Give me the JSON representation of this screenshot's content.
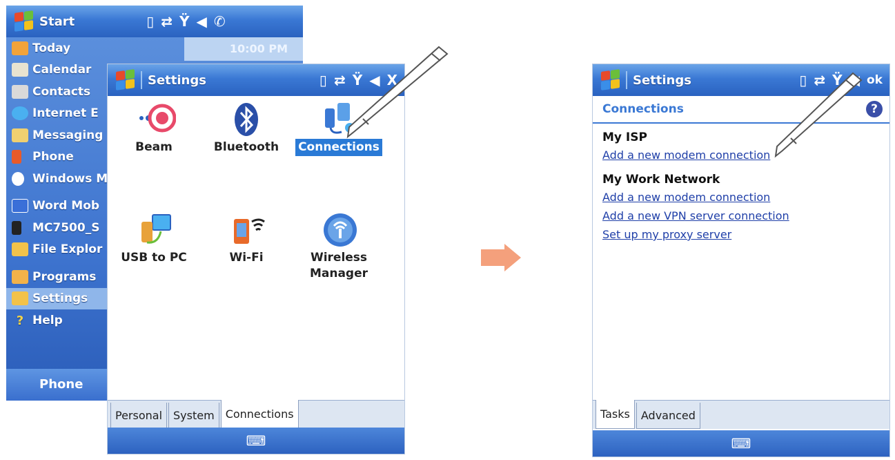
{
  "start_menu": {
    "title": "Start",
    "time": "10:00 PM",
    "items": [
      {
        "label": "Today",
        "color": "#f2a33a"
      },
      {
        "label": "Calendar",
        "color": "#e8e3d0"
      },
      {
        "label": "Contacts",
        "color": "#d9d9d9"
      },
      {
        "label": "Internet E",
        "color": "#4ab0f0"
      },
      {
        "label": "Messaging",
        "color": "#f0d070"
      },
      {
        "label": "Phone",
        "color": "#e85a2a"
      },
      {
        "label": "Windows M",
        "color": "#2a4f9a"
      },
      {
        "label": "Word Mob",
        "color": "#3a6fd8"
      },
      {
        "label": "MC7500_S",
        "color": "#222222"
      },
      {
        "label": "File Explor",
        "color": "#f2c24a"
      },
      {
        "label": "Programs",
        "color": "#f2b24a"
      },
      {
        "label": "Settings",
        "color": "#f2c24a"
      },
      {
        "label": "Help",
        "color": "#f2d24a"
      }
    ],
    "phone_softkey": "Phone"
  },
  "settings_main": {
    "title": "Settings",
    "close_label": "X",
    "icons": [
      {
        "label": "Beam",
        "icon": "beam-icon"
      },
      {
        "label": "Bluetooth",
        "icon": "bluetooth-icon"
      },
      {
        "label": "Connections",
        "icon": "connections-icon"
      },
      {
        "label": "USB to PC",
        "icon": "usb-to-pc-icon"
      },
      {
        "label": "Wi-Fi",
        "icon": "wifi-icon"
      },
      {
        "label": "Wireless Manager",
        "icon": "wireless-manager-icon"
      }
    ],
    "tabs": [
      "Personal",
      "System",
      "Connections"
    ],
    "active_tab": "Connections"
  },
  "connections_page": {
    "title": "Settings",
    "ok_label": "ok",
    "header": "Connections",
    "isp": {
      "heading": "My ISP",
      "links": [
        "Add a new modem connection"
      ]
    },
    "work": {
      "heading": "My Work Network",
      "links": [
        "Add a new modem connection",
        "Add a new VPN server connection",
        "Set up my proxy server"
      ]
    },
    "tabs": [
      "Tasks",
      "Advanced"
    ],
    "active_tab": "Tasks"
  },
  "colors": {
    "titlebar": "#3a78d4",
    "selection": "#2a7ad6",
    "link": "#1f3fa8",
    "arrow": "#f4a07c"
  }
}
